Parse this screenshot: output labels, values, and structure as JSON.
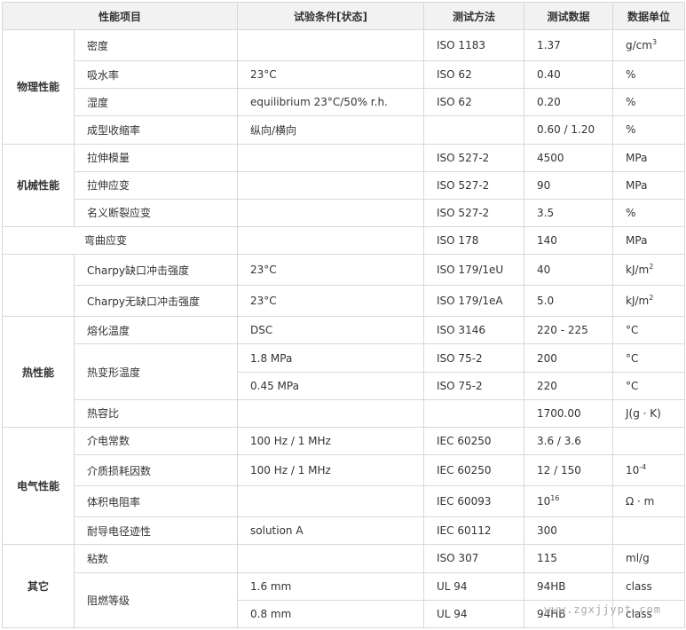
{
  "headers": [
    "性能项目",
    "试验条件[状态]",
    "测试方法",
    "测试数据",
    "数据单位"
  ],
  "groups": [
    "物理性能",
    "机械性能",
    "热性能",
    "电气性能",
    "其它"
  ],
  "rows": [
    {
      "property": "密度",
      "condition": "",
      "method": "ISO 1183",
      "value": "1.37",
      "unit": "g/cm",
      "unit_sup": "3"
    },
    {
      "property": "吸水率",
      "condition": "23°C",
      "method": "ISO 62",
      "value": "0.40",
      "unit": "%"
    },
    {
      "property": "湿度",
      "condition": "equilibrium 23°C/50% r.h.",
      "method": "ISO 62",
      "value": "0.20",
      "unit": "%"
    },
    {
      "property": "成型收缩率",
      "condition": "纵向/横向",
      "method": "",
      "value": "0.60 / 1.20",
      "unit": "%"
    },
    {
      "property": "拉伸模量",
      "condition": "",
      "method": "ISO 527-2",
      "value": "4500",
      "unit": "MPa"
    },
    {
      "property": "拉伸应变",
      "condition": "",
      "method": "ISO 527-2",
      "value": "90",
      "unit": "MPa"
    },
    {
      "property": "名义断裂应变",
      "condition": "",
      "method": "ISO 527-2",
      "value": "3.5",
      "unit": "%"
    },
    {
      "property": "弯曲应变",
      "condition": "",
      "method": "ISO 178",
      "value": "140",
      "unit": "MPa"
    },
    {
      "property": "Charpy缺口冲击强度",
      "condition": "23°C",
      "method": "ISO 179/1eU",
      "value": "40",
      "unit": "kJ/m",
      "unit_sup": "2"
    },
    {
      "property": "Charpy无缺口冲击强度",
      "condition": "23°C",
      "method": "ISO 179/1eA",
      "value": "5.0",
      "unit": "kJ/m",
      "unit_sup": "2"
    },
    {
      "property": "熔化温度",
      "condition": "DSC",
      "method": "ISO 3146",
      "value": "220 - 225",
      "unit": "°C"
    },
    {
      "property": "热变形温度",
      "condition": "1.8 MPa",
      "method": "ISO 75-2",
      "value": "200",
      "unit": "°C"
    },
    {
      "property": "",
      "condition": "0.45 MPa",
      "method": "ISO 75-2",
      "value": "220",
      "unit": "°C"
    },
    {
      "property": "热容比",
      "condition": "",
      "method": "",
      "value": "1700.00",
      "unit": "J(g · K)"
    },
    {
      "property": "介电常数",
      "condition": "100 Hz / 1 MHz",
      "method": "IEC 60250",
      "value": "3.6 / 3.6",
      "unit": ""
    },
    {
      "property": "介质损耗因数",
      "condition": "100 Hz / 1 MHz",
      "method": "IEC 60250",
      "value": "12 / 150",
      "unit": "10",
      "unit_sup": "-4"
    },
    {
      "property": "体积电阻率",
      "condition": "",
      "method": "IEC 60093",
      "value": "10",
      "value_sup": "16",
      "unit": "Ω · m"
    },
    {
      "property": "耐导电径迹性",
      "condition": "solution A",
      "method": "IEC 60112",
      "value": "300",
      "unit": ""
    },
    {
      "property": "粘数",
      "condition": "",
      "method": "ISO 307",
      "value": "115",
      "unit": "ml/g"
    },
    {
      "property": "阻燃等级",
      "condition": "1.6 mm",
      "method": "UL 94",
      "value": "94HB",
      "unit": "class"
    },
    {
      "property": "",
      "condition": "0.8 mm",
      "method": "UL 94",
      "value": "94HB",
      "unit": "class"
    }
  ],
  "watermark": "www.zgxjjypt.com"
}
